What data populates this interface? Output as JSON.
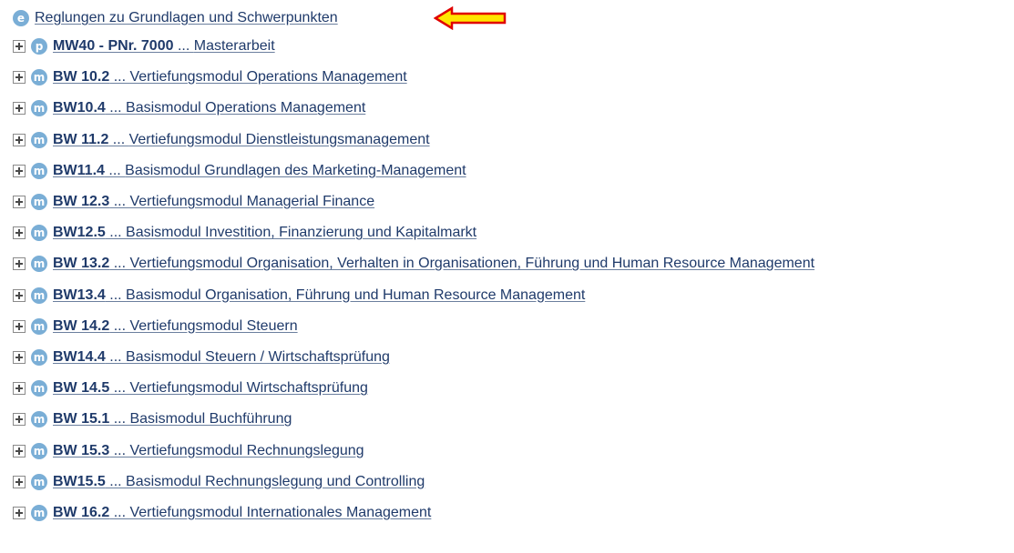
{
  "colors": {
    "link": "#1f3a6a",
    "badge": "#7aaed6",
    "arrow_fill": "#ffe600",
    "arrow_stroke": "#e00000"
  },
  "header_item": {
    "badge": "e",
    "icon": "e-circle-icon",
    "label": "Reglungen zu Grundlagen und Schwerpunkten"
  },
  "annotation_icon": "left-arrow-icon",
  "items": [
    {
      "badge": "p",
      "icon": "p-circle-icon",
      "code": "MW40 - PNr. 7000",
      "sep": " ... ",
      "title": "Masterarbeit"
    },
    {
      "badge": "m",
      "icon": "m-circle-icon",
      "code": "BW 10.2",
      "sep": " ... ",
      "title": "Vertiefungsmodul Operations Management"
    },
    {
      "badge": "m",
      "icon": "m-circle-icon",
      "code": "BW10.4",
      "sep": " ... ",
      "title": "Basismodul Operations Management"
    },
    {
      "badge": "m",
      "icon": "m-circle-icon",
      "code": "BW 11.2",
      "sep": " ... ",
      "title": "Vertiefungsmodul Dienstleistungsmanagement"
    },
    {
      "badge": "m",
      "icon": "m-circle-icon",
      "code": "BW11.4",
      "sep": " ... ",
      "title": "Basismodul Grundlagen des Marketing-Management"
    },
    {
      "badge": "m",
      "icon": "m-circle-icon",
      "code": "BW 12.3",
      "sep": " ... ",
      "title": "Vertiefungsmodul Managerial Finance"
    },
    {
      "badge": "m",
      "icon": "m-circle-icon",
      "code": "BW12.5",
      "sep": " ... ",
      "title": "Basismodul Investition, Finanzierung und Kapitalmarkt"
    },
    {
      "badge": "m",
      "icon": "m-circle-icon",
      "code": "BW 13.2",
      "sep": " ... ",
      "title": "Vertiefungsmodul Organisation, Verhalten in Organisationen, Führung und Human Resource Management"
    },
    {
      "badge": "m",
      "icon": "m-circle-icon",
      "code": "BW13.4",
      "sep": " ... ",
      "title": "Basismodul Organisation, Führung und Human Resource Management"
    },
    {
      "badge": "m",
      "icon": "m-circle-icon",
      "code": "BW 14.2",
      "sep": " ... ",
      "title": "Vertiefungsmodul Steuern"
    },
    {
      "badge": "m",
      "icon": "m-circle-icon",
      "code": "BW14.4",
      "sep": " ... ",
      "title": "Basismodul Steuern / Wirtschaftsprüfung"
    },
    {
      "badge": "m",
      "icon": "m-circle-icon",
      "code": "BW 14.5",
      "sep": " ... ",
      "title": "Vertiefungsmodul Wirtschaftsprüfung"
    },
    {
      "badge": "m",
      "icon": "m-circle-icon",
      "code": "BW 15.1",
      "sep": " ... ",
      "title": "Basismodul Buchführung"
    },
    {
      "badge": "m",
      "icon": "m-circle-icon",
      "code": "BW 15.3",
      "sep": " ... ",
      "title": "Vertiefungsmodul Rechnungslegung"
    },
    {
      "badge": "m",
      "icon": "m-circle-icon",
      "code": "BW15.5",
      "sep": " ... ",
      "title": "Basismodul Rechnungslegung und Controlling"
    },
    {
      "badge": "m",
      "icon": "m-circle-icon",
      "code": "BW 16.2",
      "sep": " ... ",
      "title": "Vertiefungsmodul Internationales Management"
    }
  ]
}
